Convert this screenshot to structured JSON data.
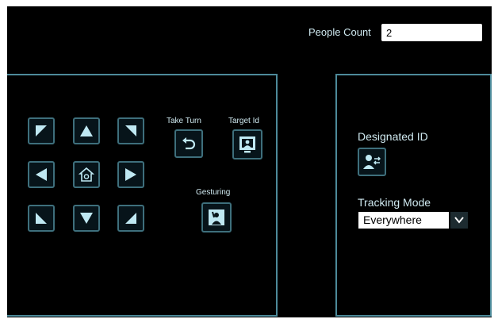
{
  "header": {
    "people_count_label": "People Count",
    "people_count_value": "2"
  },
  "movement_pad": {
    "buttons": [
      {
        "name": "move-up-left-button",
        "icon": "arrow-up-left-icon"
      },
      {
        "name": "move-up-button",
        "icon": "arrow-up-icon"
      },
      {
        "name": "move-up-right-button",
        "icon": "arrow-up-right-icon"
      },
      {
        "name": "move-left-button",
        "icon": "arrow-left-icon"
      },
      {
        "name": "home-button",
        "icon": "home-icon"
      },
      {
        "name": "move-right-button",
        "icon": "arrow-right-icon"
      },
      {
        "name": "move-down-left-button",
        "icon": "arrow-down-left-icon"
      },
      {
        "name": "move-down-button",
        "icon": "arrow-down-icon"
      },
      {
        "name": "move-down-right-button",
        "icon": "arrow-down-right-icon"
      }
    ]
  },
  "actions": {
    "take_turn_label": "Take Turn",
    "target_id_label": "Target Id",
    "gesturing_label": "Gesturing"
  },
  "tracking": {
    "designated_id_label": "Designated ID",
    "tracking_mode_label": "Tracking Mode",
    "tracking_mode_value": "Everywhere"
  },
  "colors": {
    "background": "#000000",
    "panel_border": "#4d8a9a",
    "icon_fill": "#bfe8f2",
    "text": "#cfe9f0"
  }
}
